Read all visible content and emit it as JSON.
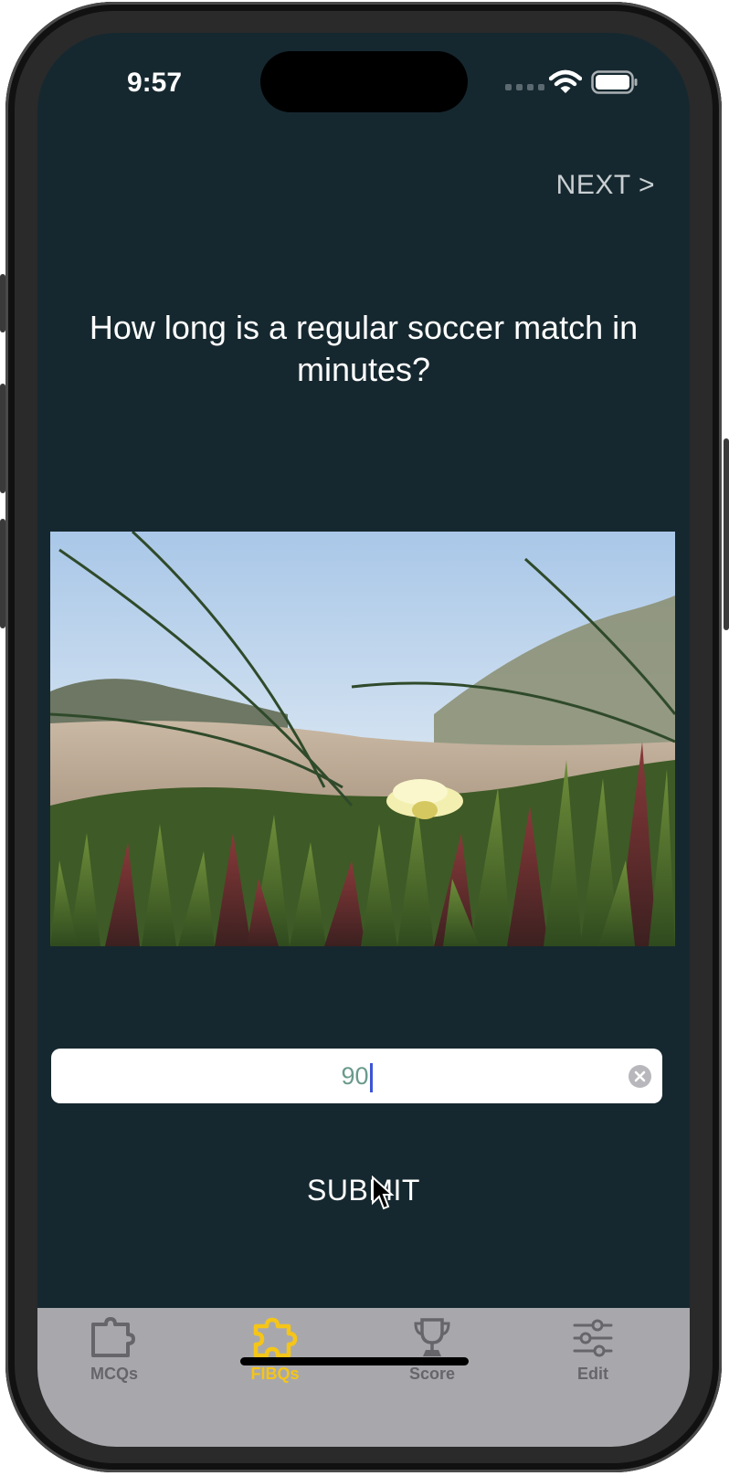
{
  "status_bar": {
    "time": "9:57"
  },
  "nav": {
    "next_label": "NEXT >"
  },
  "question": {
    "text": "How long is a regular soccer match in minutes?"
  },
  "answer_field": {
    "value": "90"
  },
  "submit_label": "SUBMIT",
  "tabs": [
    {
      "label": "MCQs",
      "icon": "puzzle-outline-icon",
      "selected": false
    },
    {
      "label": "FIBQs",
      "icon": "puzzle-icon",
      "selected": true
    },
    {
      "label": "Score",
      "icon": "trophy-icon",
      "selected": false
    },
    {
      "label": "Edit",
      "icon": "sliders-icon",
      "selected": false
    }
  ],
  "colors": {
    "background": "#16282f",
    "tab_bar": "#a8a8ac",
    "tab_selected": "#f5c518",
    "tab_unselected": "#66666a",
    "text": "#ffffff"
  }
}
